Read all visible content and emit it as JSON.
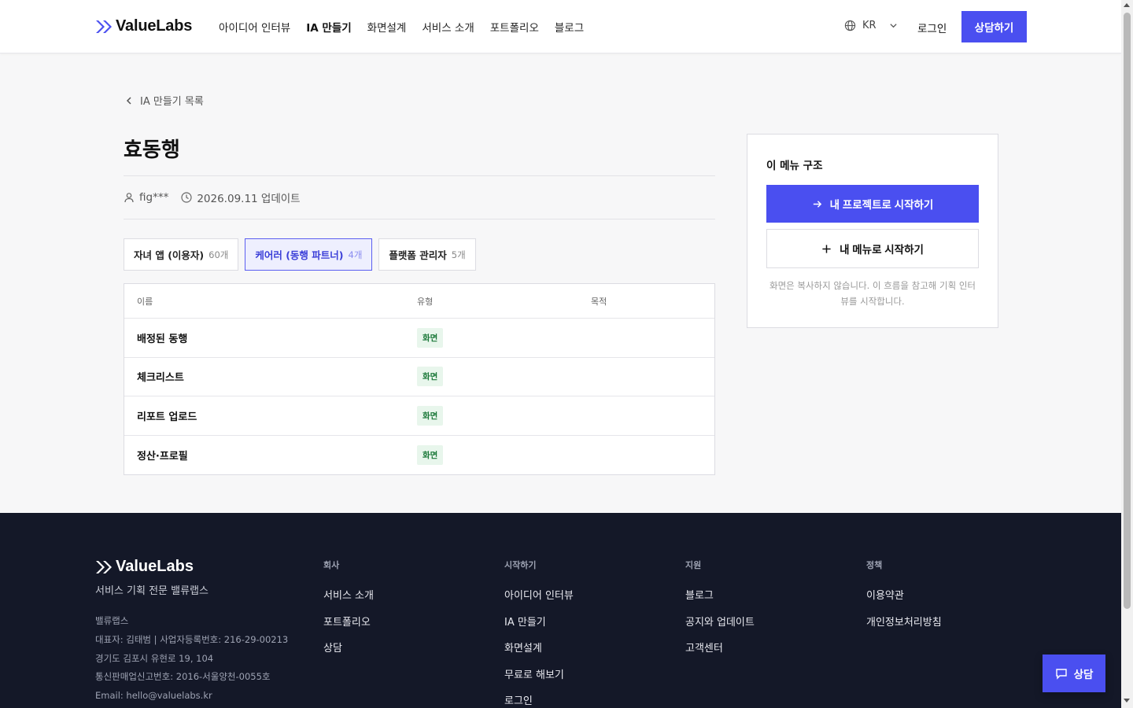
{
  "brand": {
    "name": "ValueLabs",
    "accent": "#4a4ff0"
  },
  "header": {
    "nav": [
      "아이디어 인터뷰",
      "IA 만들기",
      "화면설계",
      "서비스 소개",
      "포트폴리오",
      "블로그"
    ],
    "lang": "KR",
    "login": "로그인",
    "cta": "상담하기"
  },
  "page": {
    "back_label": "IA 만들기 목록",
    "title": "효동행",
    "author": "fig***",
    "updated": "2026.09.11 업데이트"
  },
  "tabs": [
    {
      "label": "자녀 앱 (이용자)",
      "count": "60개",
      "active": false
    },
    {
      "label": "케어러 (동행 파트너)",
      "count": "4개",
      "active": true
    },
    {
      "label": "플랫폼 관리자",
      "count": "5개",
      "active": false
    }
  ],
  "table": {
    "columns": [
      "이름",
      "유형",
      "목적"
    ],
    "rows": [
      {
        "name": "배정된 동행",
        "type": "화면",
        "purpose": ""
      },
      {
        "name": "체크리스트",
        "type": "화면",
        "purpose": ""
      },
      {
        "name": "리포트 업로드",
        "type": "화면",
        "purpose": ""
      },
      {
        "name": "정산·프로필",
        "type": "화면",
        "purpose": ""
      }
    ]
  },
  "side": {
    "title": "이 메뉴 구조",
    "primary": "내 프로젝트로 시작하기",
    "secondary": "내 메뉴로 시작하기",
    "note": "화면은 복사하지 않습니다. 이 흐름을 참고해 기획 인터뷰를 시작합니다."
  },
  "footer": {
    "tagline": "서비스 기획 전문 밸류랩스",
    "company": [
      "밸류랩스",
      "대표자: 김태범 | 사업자등록번호: 216-29-00213",
      "경기도 김포시 유현로 19, 104",
      "통신판매업신고번호: 2016-서울양천-0055호",
      "Email: hello@valuelabs.kr"
    ],
    "columns": [
      {
        "head": "회사",
        "links": [
          "서비스 소개",
          "포트폴리오",
          "상담"
        ]
      },
      {
        "head": "시작하기",
        "links": [
          "아이디어 인터뷰",
          "IA 만들기",
          "화면설계",
          "무료로 해보기",
          "로그인"
        ]
      },
      {
        "head": "지원",
        "links": [
          "블로그",
          "공지와 업데이트",
          "고객센터"
        ]
      },
      {
        "head": "정책",
        "links": [
          "이용약관",
          "개인정보처리방침"
        ]
      }
    ]
  },
  "float_button": "상담"
}
